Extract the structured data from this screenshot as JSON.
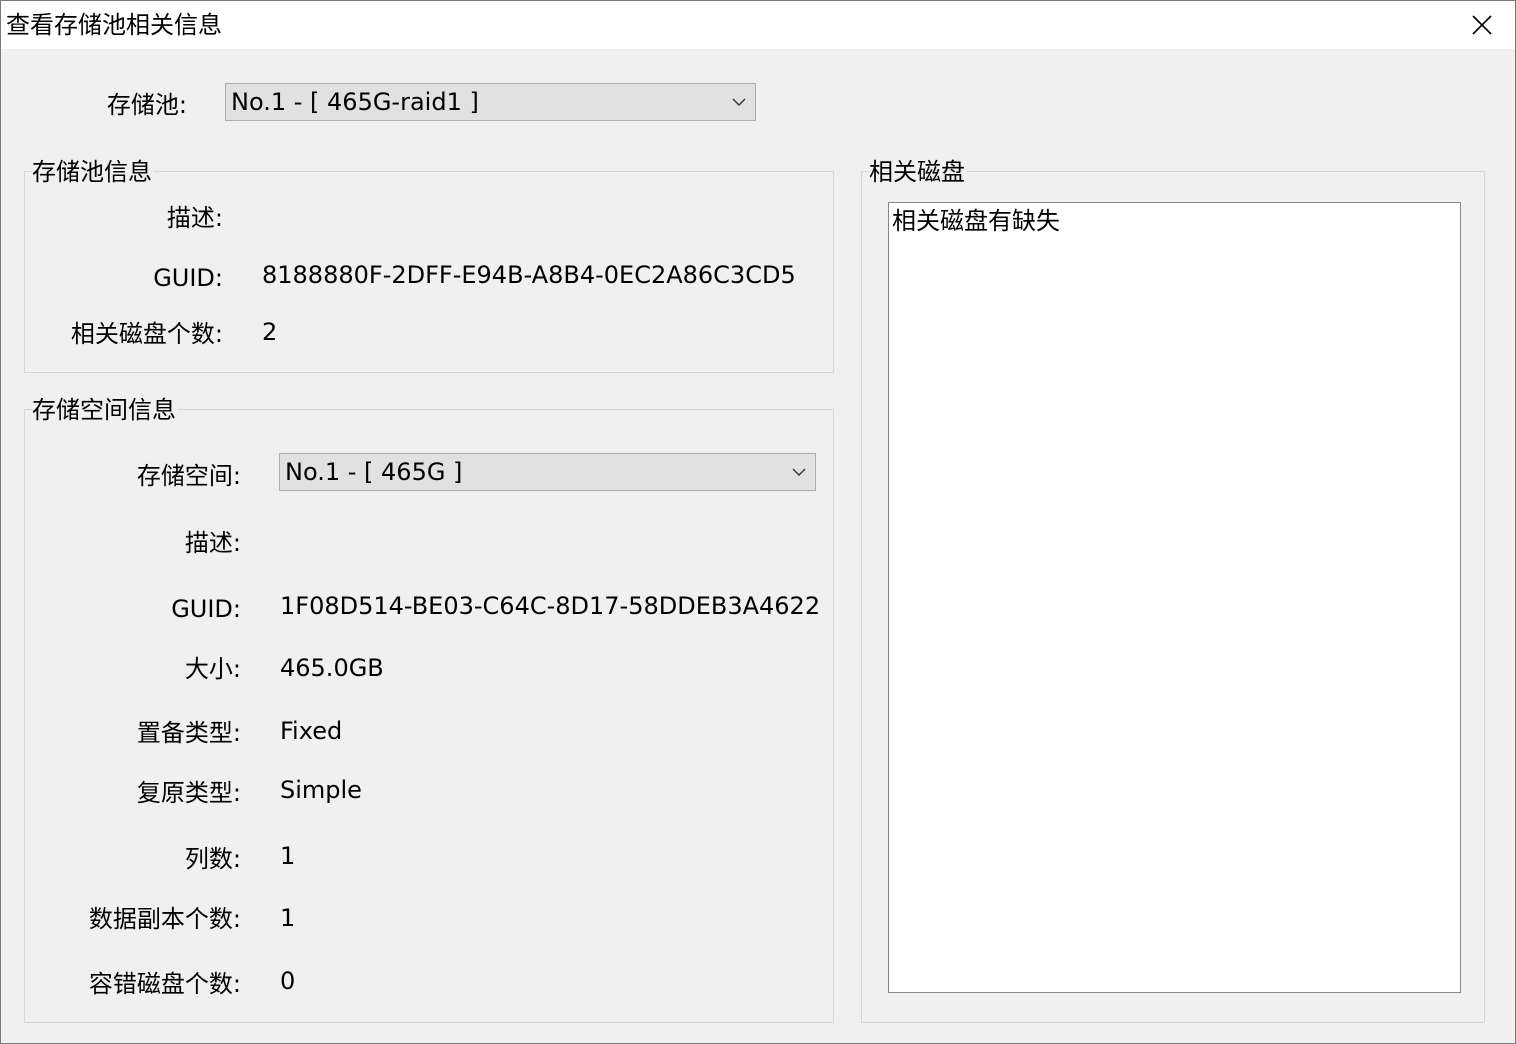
{
  "window": {
    "title": "查看存储池相关信息"
  },
  "pool": {
    "label": "存储池:",
    "selected": "No.1 - [ 465G-raid1 ]"
  },
  "pool_info": {
    "title": "存储池信息",
    "desc_label": "描述:",
    "desc_value": "",
    "guid_label": "GUID:",
    "guid_value": "8188880F-2DFF-E94B-A8B4-0EC2A86C3CD5",
    "disk_count_label": "相关磁盘个数:",
    "disk_count_value": "2"
  },
  "space_info": {
    "title": "存储空间信息",
    "space_label": "存储空间:",
    "space_selected": "No.1 - [ 465G ]",
    "desc_label": "描述:",
    "desc_value": "",
    "guid_label": "GUID:",
    "guid_value": "1F08D514-BE03-C64C-8D17-58DDEB3A4622",
    "size_label": "大小:",
    "size_value": "465.0GB",
    "provision_label": "置备类型:",
    "provision_value": "Fixed",
    "resiliency_label": "复原类型:",
    "resiliency_value": "Simple",
    "columns_label": "列数:",
    "columns_value": "1",
    "copies_label": "数据副本个数:",
    "copies_value": "1",
    "fault_tolerance_label": "容错磁盘个数:",
    "fault_tolerance_value": "0"
  },
  "related_disks": {
    "title": "相关磁盘",
    "items": [
      "相关磁盘有缺失"
    ]
  },
  "icons": {
    "close": "close-icon",
    "dropdown": "chevron-down-icon"
  }
}
